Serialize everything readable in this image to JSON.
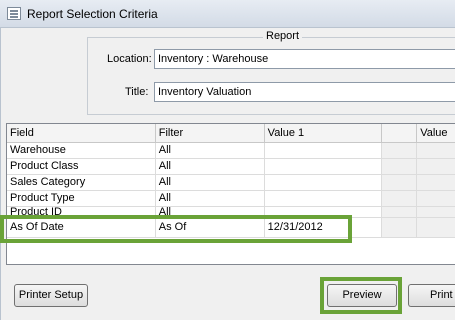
{
  "window": {
    "title": "Report Selection Criteria"
  },
  "report_group": {
    "legend": "Report",
    "location_label": "Location:",
    "location_value": "Inventory : Warehouse",
    "title_label": "Title:",
    "title_value": "Inventory Valuation"
  },
  "grid": {
    "headers": [
      "Field",
      "Filter",
      "Value 1",
      "",
      "Value"
    ],
    "rows": [
      {
        "field": "Warehouse",
        "filter": "All",
        "value1": ""
      },
      {
        "field": "Product Class",
        "filter": "All",
        "value1": ""
      },
      {
        "field": "Sales Category",
        "filter": "All",
        "value1": ""
      },
      {
        "field": "Product Type",
        "filter": "All",
        "value1": ""
      },
      {
        "field": "Product ID",
        "filter": "All",
        "value1": ""
      },
      {
        "field": "As Of Date",
        "filter": "As Of",
        "value1": "12/31/2012"
      }
    ]
  },
  "buttons": {
    "printer_setup": "Printer Setup",
    "preview": "Preview",
    "print": "Print"
  },
  "colors": {
    "highlight": "#6aa338"
  },
  "icons": {
    "app": "form-icon"
  }
}
